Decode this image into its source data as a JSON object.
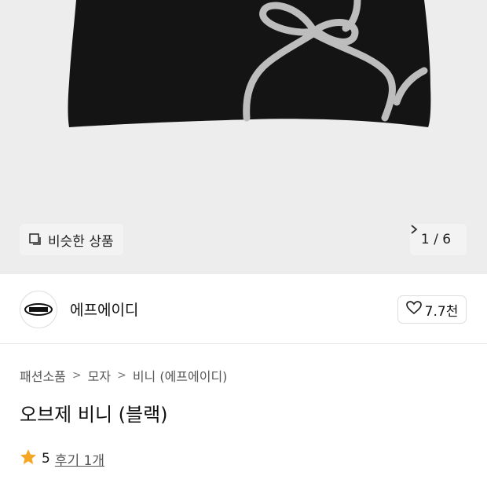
{
  "hero": {
    "similar_label": "비슷한 상품",
    "page_indicator": "1 / 6"
  },
  "brand": {
    "name": "에프에이디",
    "likes": "7.7천"
  },
  "breadcrumb": [
    "패션소품",
    "모자",
    "비니 (에프에이디)"
  ],
  "product": {
    "title": "오브제 비니 (블랙)",
    "rating": "5",
    "review_link": "후기 1개"
  },
  "colors": {
    "star": "#f5a623",
    "image_bg": "#ededed"
  }
}
